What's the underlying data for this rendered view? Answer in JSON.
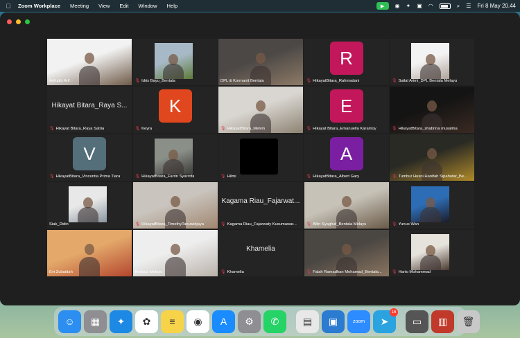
{
  "menubar": {
    "app_name": "Zoom Workplace",
    "menus": [
      "Meeting",
      "View",
      "Edit",
      "Window",
      "Help"
    ],
    "clock": "Fri 8 May  20.44",
    "status_icons": [
      "zoom-video-icon",
      "eye-icon",
      "sparkle-icon",
      "notes-icon",
      "wifi-icon",
      "battery-icon",
      "search-icon",
      "control-center-icon"
    ]
  },
  "participants": [
    {
      "name": "Arifudin Arif",
      "muted": false,
      "kind": "video",
      "colors": [
        "#f2f2f2",
        "#6e5a48"
      ]
    },
    {
      "name": "Idris Bayu_Bentala",
      "muted": true,
      "kind": "video-small",
      "colors": [
        "#a7b9c6",
        "#5d7a3a"
      ]
    },
    {
      "name": "DPL & Kormanit Bentala",
      "muted": false,
      "kind": "video",
      "colors": [
        "#4c4846",
        "#8d7a66"
      ]
    },
    {
      "name": "HikayatBitara_Rahmadani",
      "muted": true,
      "kind": "letter",
      "letter": "R",
      "bg": "#c2185b"
    },
    {
      "name": "Sailal Arimi_DPL Bentala Melayu",
      "muted": true,
      "kind": "video-small",
      "colors": [
        "#f3f3f3",
        "#b0a49b"
      ]
    },
    {
      "name": "Hikayat Bitara_Raya Satria",
      "muted": true,
      "kind": "name",
      "big": "Hikayat Bitara_Raya S..."
    },
    {
      "name": "Keyra",
      "muted": true,
      "kind": "letter",
      "letter": "K",
      "bg": "#e0471e"
    },
    {
      "name": "HikayatBitara_Melvin",
      "muted": true,
      "kind": "video",
      "colors": [
        "#d9d6d1",
        "#8e8373"
      ]
    },
    {
      "name": "Hikayat Bitara_Emanuella Karamoy",
      "muted": true,
      "kind": "letter",
      "letter": "E",
      "bg": "#c2185b"
    },
    {
      "name": "HikayatBitara_shabrina musalma",
      "muted": true,
      "kind": "video",
      "colors": [
        "#141414",
        "#3a2a22"
      ]
    },
    {
      "name": "HikayatBitara_Vincentia Prima Tiara",
      "muted": true,
      "kind": "letter",
      "letter": "V",
      "bg": "#546e7a"
    },
    {
      "name": "HikayatBitara_Farrin Syarrofa",
      "muted": true,
      "kind": "video-small",
      "colors": [
        "#8a8f88",
        "#3a3b36"
      ]
    },
    {
      "name": "Hilmi",
      "muted": true,
      "kind": "black"
    },
    {
      "name": "HikayatBitara_Albert Gary",
      "muted": true,
      "kind": "letter",
      "letter": "A",
      "bg": "#7b1fa2"
    },
    {
      "name": "Tumbur Husni Hanifah Sipahutar_Be...",
      "muted": true,
      "kind": "video",
      "colors": [
        "#2a2a24",
        "#b08a2a"
      ]
    },
    {
      "name": "Siak_Didin",
      "muted": false,
      "kind": "video-small",
      "colors": [
        "#e8e8e8",
        "#8a96a0"
      ]
    },
    {
      "name": "HikayatBitara_TimothyTanuwidjaya",
      "muted": true,
      "kind": "video",
      "colors": [
        "#c9c4bd",
        "#a08670"
      ]
    },
    {
      "name": "Kagama Riau_Fajarwaty Kusumawar...",
      "muted": true,
      "kind": "name",
      "big": "Kagama Riau_Fajarwat..."
    },
    {
      "name": "Alfin Syaghaf_Bentala Melayu",
      "muted": true,
      "kind": "video",
      "colors": [
        "#c7c2b8",
        "#6a5a48"
      ]
    },
    {
      "name": "Yunus Wan",
      "muted": true,
      "kind": "video-small",
      "colors": [
        "#2d6db5",
        "#1c1c2a"
      ]
    },
    {
      "name": "Evi Zubaidah",
      "muted": false,
      "kind": "video",
      "colors": [
        "#e3a86a",
        "#b4472e"
      ]
    },
    {
      "name": "Bentala Melayu",
      "muted": false,
      "kind": "video",
      "colors": [
        "#eeeeee",
        "#b9b2aa"
      ],
      "active": true
    },
    {
      "name": "Khamelia",
      "muted": true,
      "kind": "name",
      "big": "Khamelia"
    },
    {
      "name": "Falah Ramadhan Mohamad_Bentala...",
      "muted": true,
      "kind": "video",
      "colors": [
        "#4a4642",
        "#8a7560"
      ]
    },
    {
      "name": "Harto Mohammad",
      "muted": true,
      "kind": "video-small",
      "colors": [
        "#e6e2dc",
        "#4a3a30"
      ]
    }
  ],
  "dock": [
    {
      "name": "finder",
      "glyph": "☺",
      "color": "#2b8ef0"
    },
    {
      "name": "launchpad",
      "glyph": "▦",
      "color": "#8e8e93"
    },
    {
      "name": "safari",
      "glyph": "✦",
      "color": "#1e88e5"
    },
    {
      "name": "photos",
      "glyph": "✿",
      "color": "#ffffff"
    },
    {
      "name": "notes",
      "glyph": "≡",
      "color": "#f7d34a"
    },
    {
      "name": "chrome",
      "glyph": "◉",
      "color": "#ffffff"
    },
    {
      "name": "app-store",
      "glyph": "A",
      "color": "#1a8cff"
    },
    {
      "name": "system-settings",
      "glyph": "⚙",
      "color": "#8e8e93"
    },
    {
      "name": "whatsapp",
      "glyph": "✆",
      "color": "#25d366"
    },
    {
      "name": "sep"
    },
    {
      "name": "spreadsheet",
      "glyph": "▤",
      "color": "#e8e8e8"
    },
    {
      "name": "preview",
      "glyph": "▣",
      "color": "#2b7bd1"
    },
    {
      "name": "zoom",
      "glyph": "zoom",
      "color": "#2d8cff"
    },
    {
      "name": "telegram",
      "glyph": "➤",
      "color": "#2aa3e0",
      "badge": "16"
    },
    {
      "name": "sep"
    },
    {
      "name": "screen-viewer",
      "glyph": "▭",
      "color": "#555555"
    },
    {
      "name": "archive",
      "glyph": "▥",
      "color": "#c0392b"
    },
    {
      "name": "trash",
      "glyph": "🗑",
      "color": "#c8c8c8"
    }
  ]
}
